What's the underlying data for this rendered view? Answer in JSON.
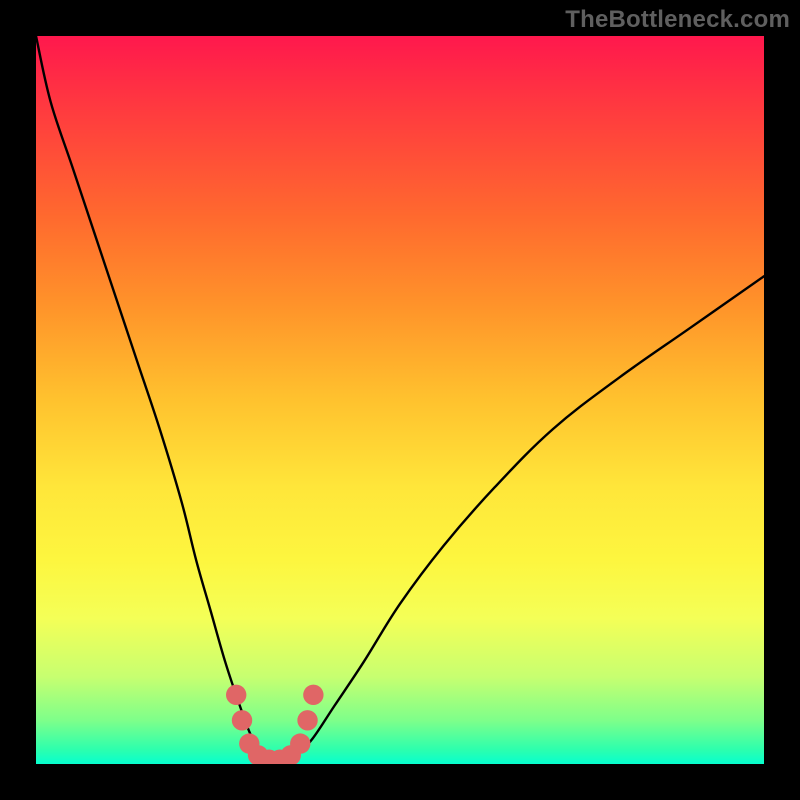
{
  "attribution": "TheBottleneck.com",
  "chart_data": {
    "type": "line",
    "title": "",
    "xlabel": "",
    "ylabel": "",
    "xlim": [
      0,
      100
    ],
    "ylim": [
      0,
      100
    ],
    "grid": false,
    "legend": false,
    "background": {
      "type": "vertical-gradient",
      "stops": [
        {
          "pct": 0,
          "color": "#ff184d"
        },
        {
          "pct": 50,
          "color": "#ffe63a"
        },
        {
          "pct": 100,
          "color": "#06ffcf"
        }
      ]
    },
    "series": [
      {
        "name": "bottleneck-curve",
        "color": "#000000",
        "x": [
          0,
          2,
          5,
          8,
          11,
          14,
          17,
          20,
          22,
          24,
          26,
          28,
          29.5,
          31,
          32.5,
          34,
          36,
          38,
          41,
          45,
          50,
          56,
          63,
          71,
          80,
          90,
          100
        ],
        "y": [
          100,
          91,
          82,
          73,
          64,
          55,
          46,
          36,
          28,
          21,
          14,
          8,
          4,
          1.5,
          0.5,
          0.5,
          1.5,
          3.5,
          8,
          14,
          22,
          30,
          38,
          46,
          53,
          60,
          67
        ]
      }
    ],
    "markers": {
      "name": "valley-markers",
      "color": "#e06666",
      "radius": 1.4,
      "points": [
        {
          "x": 27.5,
          "y": 9.5
        },
        {
          "x": 28.3,
          "y": 6.0
        },
        {
          "x": 29.3,
          "y": 2.8
        },
        {
          "x": 30.5,
          "y": 1.2
        },
        {
          "x": 32.0,
          "y": 0.6
        },
        {
          "x": 33.5,
          "y": 0.6
        },
        {
          "x": 35.0,
          "y": 1.2
        },
        {
          "x": 36.3,
          "y": 2.8
        },
        {
          "x": 37.3,
          "y": 6.0
        },
        {
          "x": 38.1,
          "y": 9.5
        }
      ]
    }
  }
}
